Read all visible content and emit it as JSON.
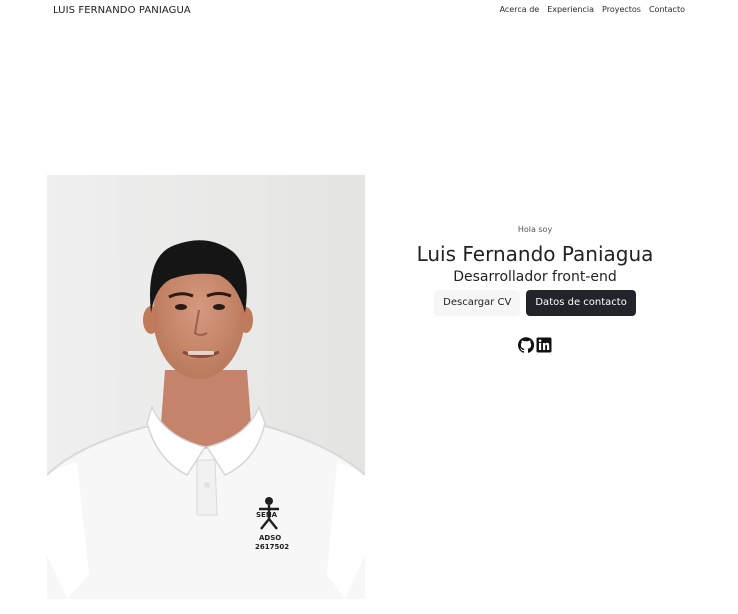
{
  "header": {
    "logo": "LUIS FERNANDO PANIAGUA",
    "nav": [
      "Acerca de",
      "Experiencia",
      "Proyectos",
      "Contacto"
    ]
  },
  "hero": {
    "greeting": "Hola soy",
    "name": "Luis Fernando Paniagua",
    "role": "Desarrollador front-end",
    "buttons": {
      "cv": "Descargar CV",
      "contact": "Datos de contacto"
    },
    "socials": [
      "github-icon",
      "linkedin-icon"
    ]
  },
  "photo": {
    "shirt_logo": "SENA",
    "shirt_text": [
      "ADSO",
      "2617502"
    ]
  },
  "colors": {
    "dark_button": "#212529",
    "light_button": "#f6f6f6",
    "orange_backdrop": "#e85d12"
  }
}
